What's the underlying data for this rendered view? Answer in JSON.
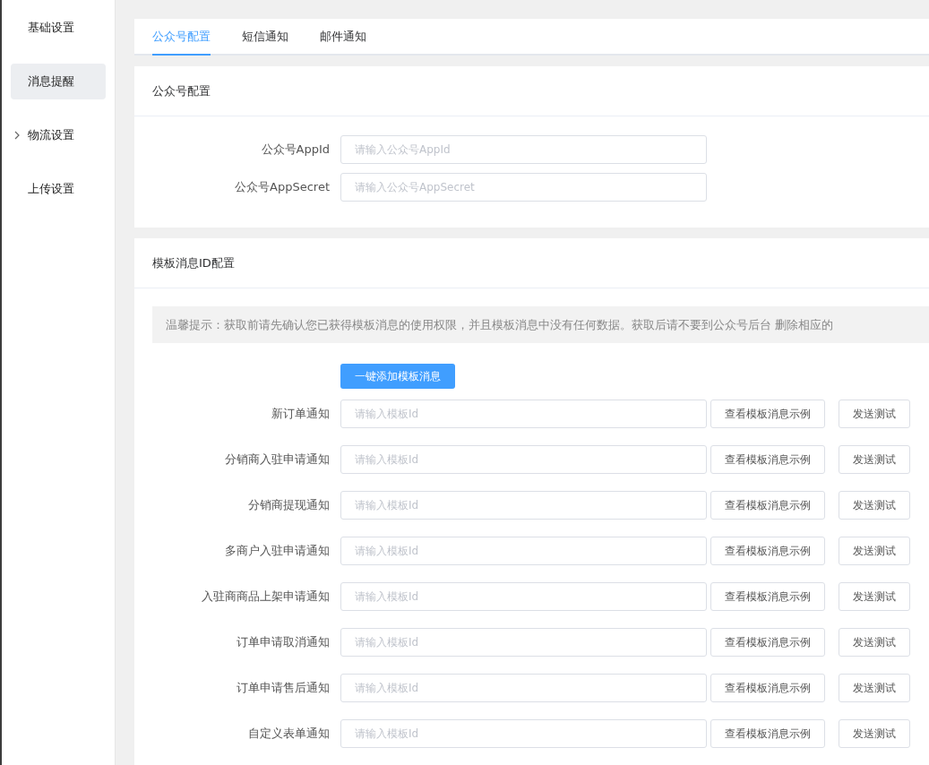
{
  "sidebar": {
    "items": [
      {
        "label": "基础设置",
        "selected": false,
        "expandable": false
      },
      {
        "label": "消息提醒",
        "selected": true,
        "expandable": false
      },
      {
        "label": "物流设置",
        "selected": false,
        "expandable": true
      },
      {
        "label": "上传设置",
        "selected": false,
        "expandable": false
      }
    ]
  },
  "tabs": [
    {
      "label": "公众号配置",
      "selected": true
    },
    {
      "label": "短信通知",
      "selected": false
    },
    {
      "label": "邮件通知",
      "selected": false
    }
  ],
  "account_section": {
    "title": "公众号配置",
    "fields": [
      {
        "label": "公众号AppId",
        "placeholder": "请输入公众号AppId"
      },
      {
        "label": "公众号AppSecret",
        "placeholder": "请输入公众号AppSecret"
      }
    ]
  },
  "template_section": {
    "title": "模板消息ID配置",
    "notice": "温馨提示：获取前请先确认您已获得模板消息的使用权限，并且模板消息中没有任何数据。获取后请不要到公众号后台 删除相应的",
    "add_button": "一键添加模板消息",
    "rows": [
      {
        "label": "新订单通知",
        "placeholder": "请输入模板Id",
        "example_button": "查看模板消息示例",
        "test_button": "发送测试"
      },
      {
        "label": "分销商入驻申请通知",
        "placeholder": "请输入模板Id",
        "example_button": "查看模板消息示例",
        "test_button": "发送测试"
      },
      {
        "label": "分销商提现通知",
        "placeholder": "请输入模板Id",
        "example_button": "查看模板消息示例",
        "test_button": "发送测试"
      },
      {
        "label": "多商户入驻申请通知",
        "placeholder": "请输入模板Id",
        "example_button": "查看模板消息示例",
        "test_button": "发送测试"
      },
      {
        "label": "入驻商商品上架申请通知",
        "placeholder": "请输入模板Id",
        "example_button": "查看模板消息示例",
        "test_button": "发送测试"
      },
      {
        "label": "订单申请取消通知",
        "placeholder": "请输入模板Id",
        "example_button": "查看模板消息示例",
        "test_button": "发送测试"
      },
      {
        "label": "订单申请售后通知",
        "placeholder": "请输入模板Id",
        "example_button": "查看模板消息示例",
        "test_button": "发送测试"
      },
      {
        "label": "自定义表单通知",
        "placeholder": "请输入模板Id",
        "example_button": "查看模板消息示例",
        "test_button": "发送测试"
      }
    ]
  }
}
